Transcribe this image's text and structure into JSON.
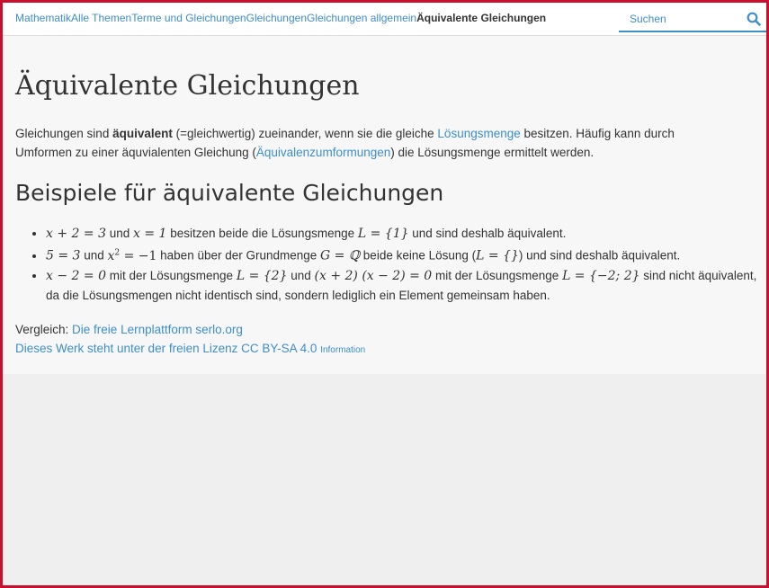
{
  "breadcrumb": {
    "items": [
      "Mathematik",
      "Alle Themen",
      "Terme und Gleichungen",
      "Gleichungen",
      "Gleichungen allgemein"
    ],
    "current": "Äquivalente Gleichungen"
  },
  "search": {
    "placeholder": "Suchen"
  },
  "page": {
    "title": "Äquivalente Gleichungen",
    "intro": {
      "p1": "Gleichungen sind ",
      "bold": "äquivalent",
      "p2": " (=gleichwertig) zueinander, wenn sie die gleiche ",
      "link1": "Lösungsmenge",
      "p3": " besitzen. Häufig kann durch Umformen zu einer äquvialenten Gleichung (",
      "link2": "Äquivalenzumformungen",
      "p4": ") die Lösungsmenge ermittelt werden."
    },
    "section_title": "Beispiele für äquivalente Gleichungen",
    "examples": [
      {
        "m1": "x + 2 = 3",
        "t1": " und ",
        "m2": "x  =  1",
        "t2": " besitzen beide die Lösungsmenge ",
        "m3": "L = {1}",
        "t3": " und sind deshalb äquivalent."
      },
      {
        "m1": "5 = 3",
        "t1": " und ",
        "m2a": "x",
        "m2sup": "2",
        "m2b": " = −1",
        "t2": " haben über der Grundmenge ",
        "m3": "G = ℚ",
        "t3": " beide keine Lösung (",
        "m4": "L = {}",
        "t4": ") und sind deshalb äquivalent."
      },
      {
        "m1": "x − 2 = 0",
        "t1": " mit der Lösungsmenge ",
        "m2": "L = {2}",
        "t2": " und ",
        "m3": "(x + 2) (x − 2) = 0",
        "t3": " mit der Lösungsmenge ",
        "m4": "L = {−2; 2}",
        "t4": " sind nicht äquivalent, da die Lösungsmengen nicht identisch sind, sondern lediglich ein Element gemeinsam haben."
      }
    ]
  },
  "footer": {
    "compare_label": "Vergleich: ",
    "compare_link": "Die freie Lernplattform serlo.org",
    "license_link": "Dieses Werk steht unter der freien Lizenz CC BY-SA 4.0",
    "info_link": "Information"
  },
  "colors": {
    "accent": "#3d8ec9",
    "frame": "#c8102e"
  }
}
